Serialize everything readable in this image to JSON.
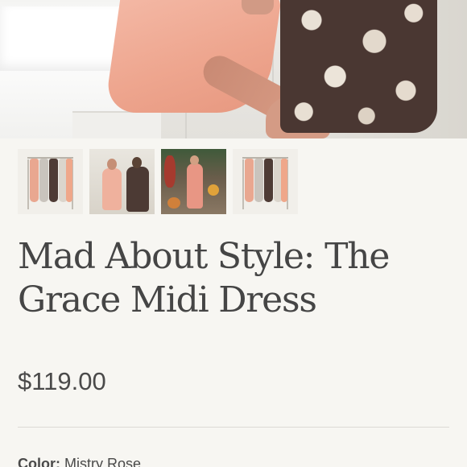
{
  "product": {
    "title": "Mad About Style: The Grace Midi Dress",
    "price": "$119.00",
    "color_label": "Color:",
    "color_value": "Mistry Rose"
  },
  "gallery": {
    "thumbnails": [
      {
        "label": "dresses on rack"
      },
      {
        "label": "two women in dresses"
      },
      {
        "label": "woman on porch"
      },
      {
        "label": "dresses on rack"
      }
    ]
  },
  "colors": {
    "background": "#f7f6f2",
    "text": "#4a4a4a",
    "pink_dress": "#eea68f",
    "floral_dark": "#4a3732",
    "divider": "#dcdad5"
  }
}
